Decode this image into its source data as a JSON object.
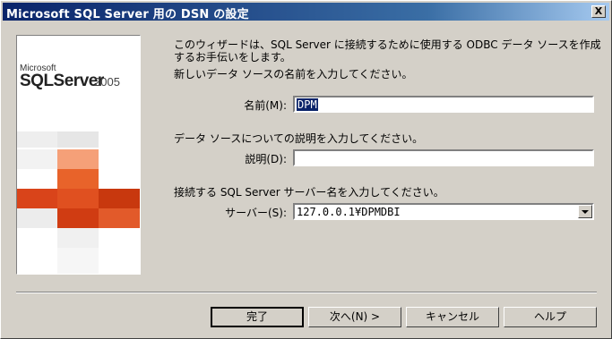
{
  "window": {
    "title": "Microsoft SQL Server 用の DSN の設定",
    "close_label": "X"
  },
  "banner": {
    "brand": "Microsoft",
    "product": "SQLServer",
    "version": "2005"
  },
  "intro": {
    "line1": "このウィザードは、SQL Server に接続するために使用する ODBC データ ソースを作成",
    "line2": "するお手伝いをします。"
  },
  "name_section": {
    "prompt": "新しいデータ ソースの名前を入力してください。",
    "label": "名前(M):",
    "value": "DPM"
  },
  "desc_section": {
    "prompt": "データ ソースについての説明を入力してください。",
    "label": "説明(D):",
    "value": ""
  },
  "server_section": {
    "prompt": "接続する SQL Server サーバー名を入力してください。",
    "label": "サーバー(S):",
    "value": "127.0.0.1¥DPMDBI"
  },
  "buttons": {
    "finish": "完了",
    "next": "次へ(N) >",
    "cancel": "キャンセル",
    "help": "ヘルプ"
  },
  "colors": {
    "titlebar": "#0a246a",
    "accent_orange": "#e8632a",
    "accent_red": "#c8380e"
  }
}
